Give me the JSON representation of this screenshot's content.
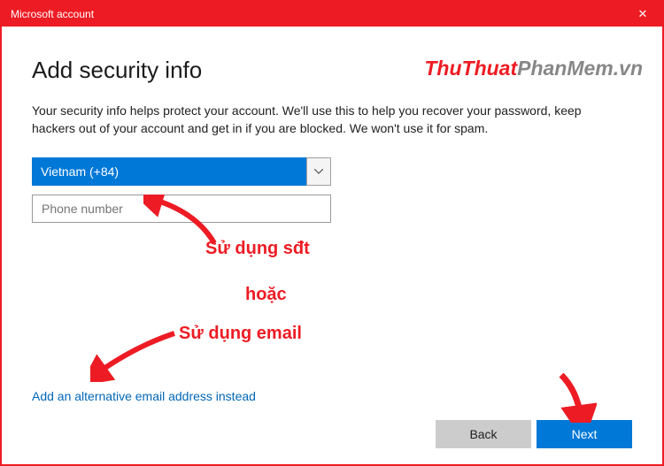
{
  "window": {
    "title": "Microsoft account"
  },
  "page": {
    "heading": "Add security info",
    "description": "Your security info helps protect your account. We'll use this to help you recover your password, keep hackers out of your account and get in if you are blocked. We won't use it for spam.",
    "country_selected": "Vietnam (+84)",
    "phone_placeholder": "Phone number",
    "alt_email_link": "Add an alternative email address instead"
  },
  "buttons": {
    "back": "Back",
    "next": "Next"
  },
  "watermark": {
    "part1": "ThuThuat",
    "part2": "PhanMem",
    "part3": ".vn"
  },
  "annotations": {
    "use_phone": "Sử dụng sđt",
    "or": "hoặc",
    "use_email": "Sử dụng email"
  }
}
